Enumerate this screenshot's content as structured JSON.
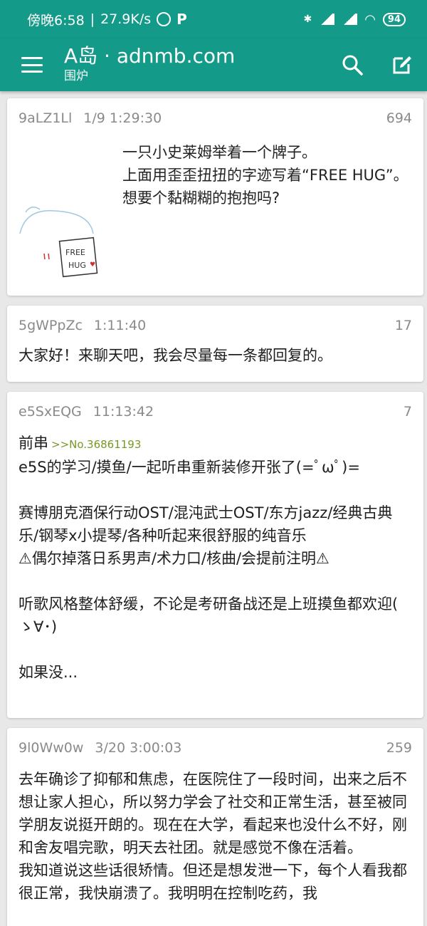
{
  "status": {
    "time": "傍晚6:58",
    "speed": "27.9K/s",
    "battery": "94"
  },
  "appbar": {
    "title": "A岛 · adnmb.com",
    "subtitle": "围炉"
  },
  "posts": [
    {
      "uid": "9aLZ1Ll",
      "time": "1/9 1:29:30",
      "count": "694",
      "lines": [
        "一只小史莱姆举着一个牌子。",
        "上面用歪歪扭扭的字迹写着“FREE HUG”。",
        "想要个黏糊糊的抱抱吗?"
      ],
      "image_text": [
        "FREE",
        "HUG"
      ]
    },
    {
      "uid": "5gWPpZc",
      "time": "1:11:40",
      "count": "17",
      "lines": [
        "大家好！来聊天吧，我会尽量每一条都回复的。"
      ]
    },
    {
      "uid": "e5SxEQG",
      "time": "11:13:42",
      "count": "7",
      "prefix": "前串",
      "quote": ">>No.36861193",
      "lines": [
        "e5S的学习/摸鱼/一起听串重新装修开张了(=ﾟωﾟ)=",
        "",
        "赛博朋克酒保行动OST/混沌武士OST/东方jazz/经典古典乐/钢琴x小提琴/各种听起来很舒服的纯音乐",
        "⚠偶尔掉落日系男声/术力口/核曲/会提前注明⚠",
        "",
        "听歌风格整体舒缓，不论是考研备战还是上班摸鱼都欢迎( ゝ∀･)",
        "",
        "如果没..."
      ]
    },
    {
      "uid": "9l0Ww0w",
      "time": "3/20 3:00:03",
      "count": "259",
      "lines": [
        "去年确诊了抑郁和焦虑，在医院住了一段时间，出来之后不想让家人担心，所以努力学会了社交和正常生活，甚至被同学朋友说挺开朗的。现在在大学，看起来也没什么不好，刚和舍友唱完歌，明天去社团。就是感觉不像在活着。",
        "我知道说这些话很矫情。但还是想发泄一下，每个人看我都很正常，我快崩溃了。我明明在控制吃药，我"
      ]
    }
  ]
}
